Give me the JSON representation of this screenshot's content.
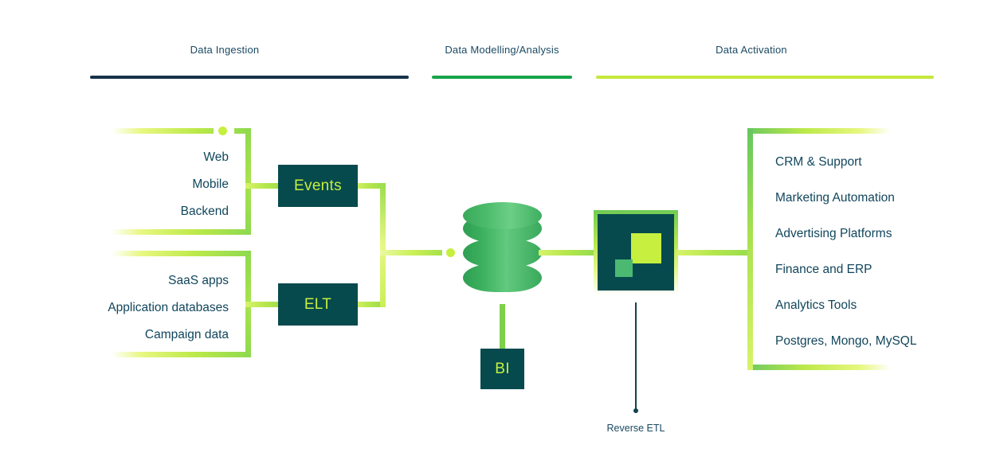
{
  "sections": [
    {
      "label": "Data Ingestion",
      "color": "#17324b"
    },
    {
      "label": "Data Modelling/Analysis",
      "color": "#16a34a"
    },
    {
      "label": "Data Activation",
      "color": "#c6e83c"
    }
  ],
  "sources": {
    "group_a": [
      "Web",
      "Mobile",
      "Backend"
    ],
    "group_b": [
      "SaaS apps",
      "Application databases",
      "Campaign data"
    ]
  },
  "processes": {
    "events": "Events",
    "elt": "ELT",
    "bi": "BI"
  },
  "warehouse": {
    "name": "data-warehouse"
  },
  "reverse_etl": {
    "label": "Reverse ETL"
  },
  "destinations": [
    "CRM & Support",
    "Marketing Automation",
    "Advertising Platforms",
    "Finance and ERP",
    "Analytics Tools",
    "Postgres, Mongo, MySQL"
  ],
  "colors": {
    "dark_teal": "#064a4e",
    "lime": "#c6ef3f",
    "green": "#3cb15e",
    "navy": "#17324b",
    "text": "#11465c"
  }
}
